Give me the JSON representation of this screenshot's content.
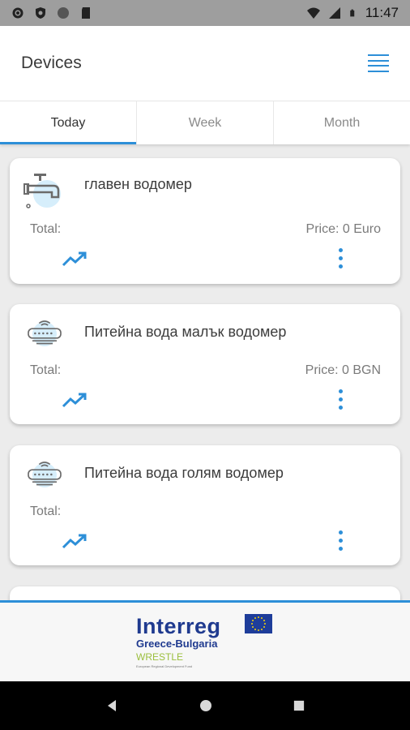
{
  "status_bar": {
    "time": "11:47",
    "icons": [
      "settings-icon",
      "shield-icon",
      "circle-icon",
      "sd-card-icon",
      "wifi-icon",
      "signal-icon",
      "battery-icon"
    ]
  },
  "header": {
    "title": "Devices",
    "menu_icon": "menu-lines-icon"
  },
  "tabs": [
    {
      "label": "Today",
      "active": true
    },
    {
      "label": "Week",
      "active": false
    },
    {
      "label": "Month",
      "active": false
    }
  ],
  "devices": [
    {
      "name": "главен водомер",
      "icon": "water-tap-icon",
      "total_label": "Total:",
      "price": "Price: 0 Euro"
    },
    {
      "name": "Питейна вода малък водомер",
      "icon": "water-meter-icon",
      "total_label": "Total:",
      "price": "Price: 0 BGN"
    },
    {
      "name": "Питейна вода голям водомер",
      "icon": "water-meter-icon",
      "total_label": "Total:",
      "price": ""
    }
  ],
  "footer": {
    "logo_title": "Interreg",
    "logo_region": "Greece-Bulgaria",
    "logo_project": "WRESTLE",
    "logo_fine": "European Regional Development Fund"
  },
  "colors": {
    "accent": "#2d8fd8",
    "logo_blue": "#1f3a8f",
    "project_green": "#9bbf3d",
    "status_bar": "#9e9e9e"
  }
}
